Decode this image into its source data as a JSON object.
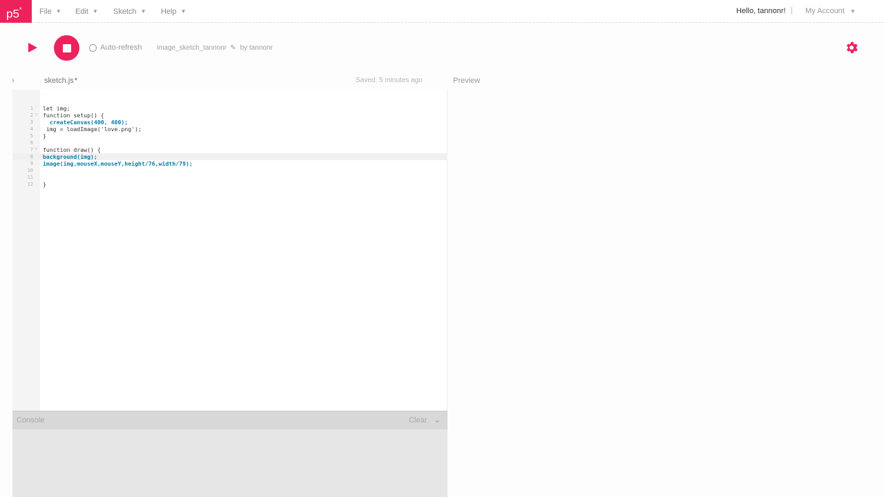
{
  "nav": {
    "logo": "p5",
    "logo_star": "*",
    "menus": [
      {
        "label": "File"
      },
      {
        "label": "Edit"
      },
      {
        "label": "Sketch"
      },
      {
        "label": "Help"
      }
    ],
    "greeting": "Hello, tannonr!",
    "separator": "|",
    "account": "My Account"
  },
  "toolbar": {
    "auto_refresh": "Auto-refresh",
    "sketch_name": "image_sketch_tannonr",
    "by_user": "by tannonr"
  },
  "editor": {
    "file_name": "sketch.js",
    "unsaved_mark": "*",
    "saved_status": "Saved: 5 minutes ago",
    "preview_label": "Preview",
    "line_numbers": [
      "1",
      "2",
      "3",
      "4",
      "5",
      "6",
      "7",
      "8",
      "9",
      "10",
      "11",
      "12"
    ],
    "code_lines": [
      "let img;",
      "function setup() {",
      "  createCanvas(400, 400);",
      " img = loadImage('love.png');",
      "}",
      "",
      "function draw() {",
      "background(img);",
      "image(img,mouseX,mouseY,height/76,width/79);",
      "",
      "",
      "}"
    ]
  },
  "console": {
    "label": "Console",
    "clear": "Clear"
  },
  "colors": {
    "accent": "#ed225d"
  }
}
